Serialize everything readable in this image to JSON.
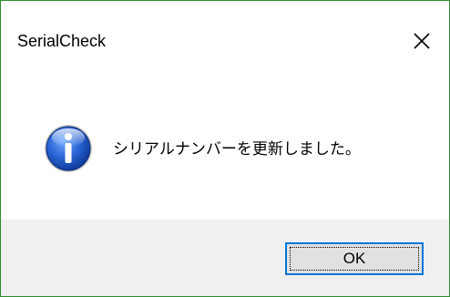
{
  "window": {
    "title": "SerialCheck",
    "close_glyph": "close-icon",
    "border_color": "#2e8b2e"
  },
  "dialog": {
    "icon": "info-icon",
    "icon_color": "#1e5fbf",
    "message": "シリアルナンバーを更新しました。"
  },
  "buttons": {
    "ok_label": "OK",
    "ok_border_color": "#0078d7"
  }
}
